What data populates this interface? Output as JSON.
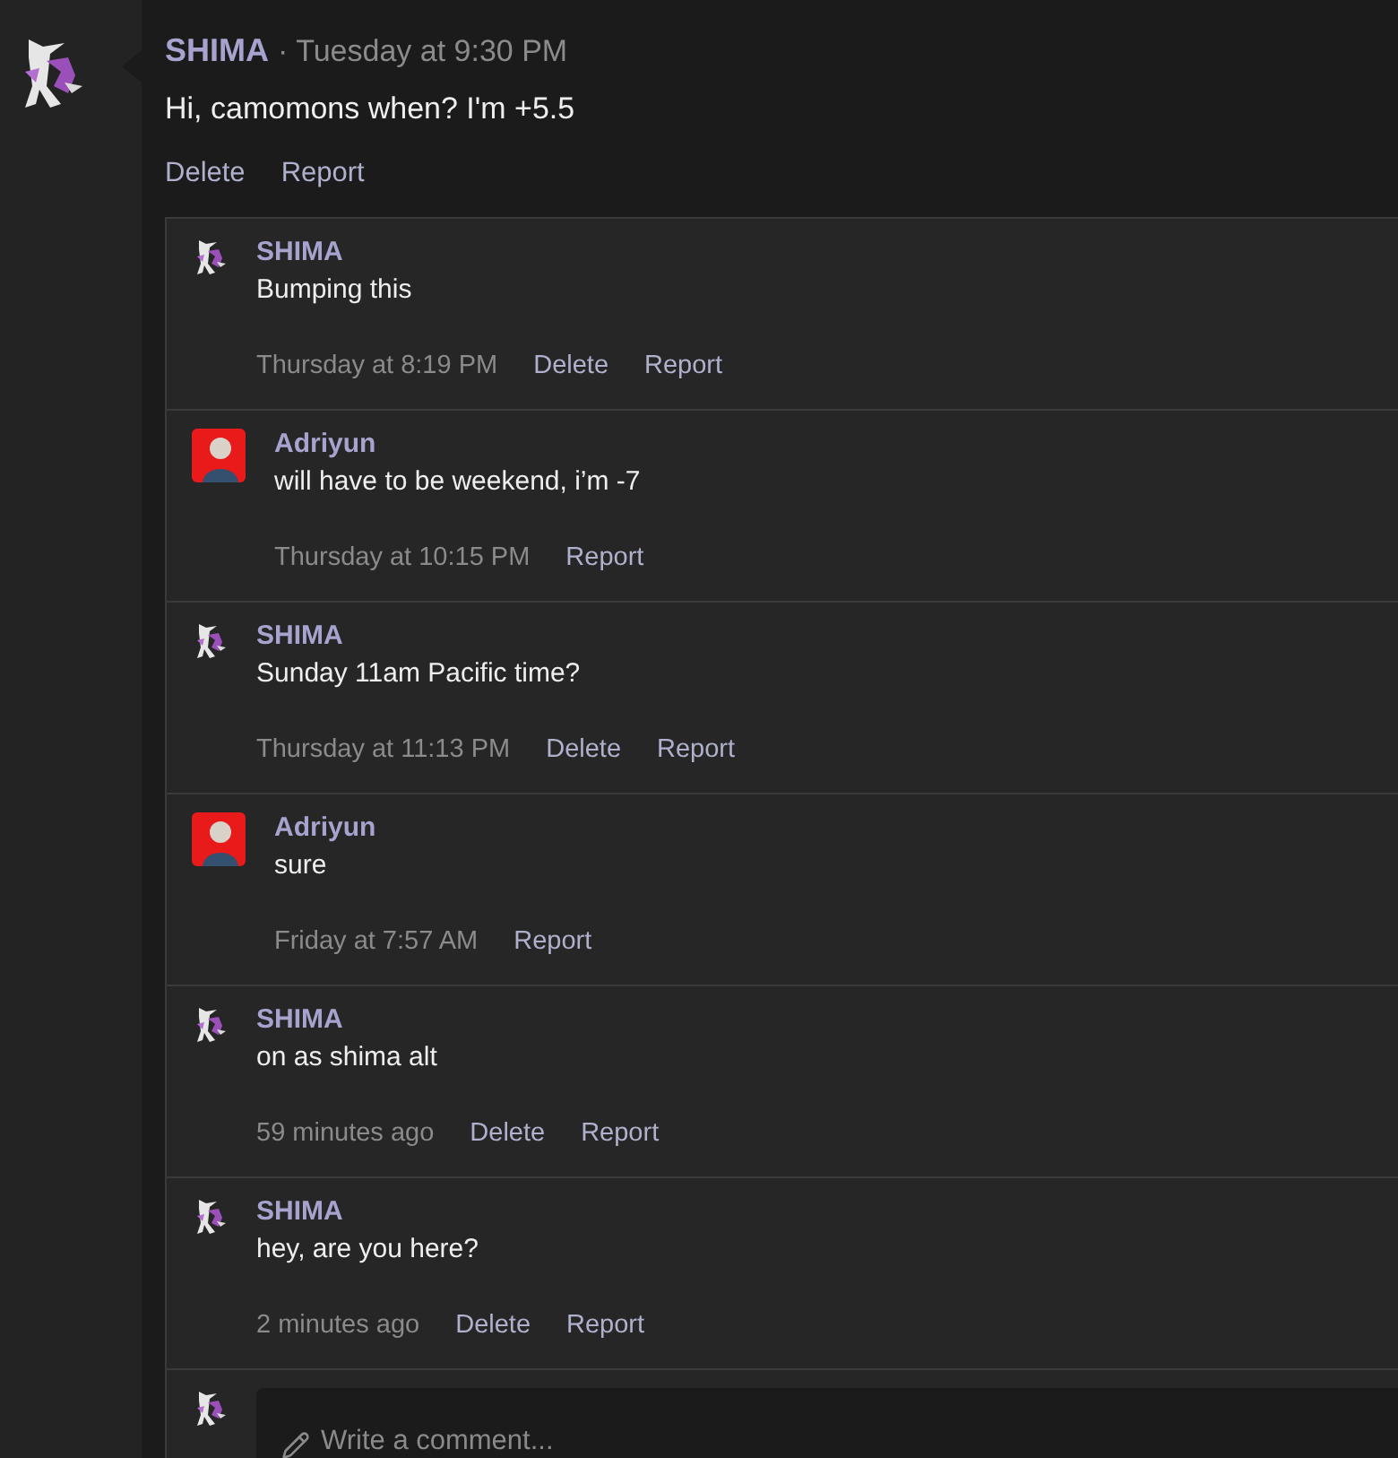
{
  "post": {
    "author": "SHIMA",
    "avatar": {
      "kind": "shima"
    },
    "time": "· Tuesday at 9:30 PM",
    "text": "Hi, camomons when? I'm +5.5",
    "actions": [
      "Delete",
      "Report"
    ]
  },
  "comments": [
    {
      "author": "SHIMA",
      "avatar": {
        "kind": "shima"
      },
      "text": "Bumping this",
      "time": "Thursday at 8:19 PM",
      "actions": [
        "Delete",
        "Report"
      ]
    },
    {
      "author": "Adriyun",
      "avatar": {
        "kind": "adriyun"
      },
      "text": "will have to be weekend, i’m -7",
      "time": "Thursday at 10:15 PM",
      "actions": [
        "Report"
      ]
    },
    {
      "author": "SHIMA",
      "avatar": {
        "kind": "shima"
      },
      "text": "Sunday 11am Pacific time?",
      "time": "Thursday at 11:13 PM",
      "actions": [
        "Delete",
        "Report"
      ]
    },
    {
      "author": "Adriyun",
      "avatar": {
        "kind": "adriyun"
      },
      "text": "sure",
      "time": "Friday at 7:57 AM",
      "actions": [
        "Report"
      ]
    },
    {
      "author": "SHIMA",
      "avatar": {
        "kind": "shima"
      },
      "text": "on as shima alt",
      "time": "59 minutes ago",
      "actions": [
        "Delete",
        "Report"
      ]
    },
    {
      "author": "SHIMA",
      "avatar": {
        "kind": "shima"
      },
      "text": "hey, are you here?",
      "time": "2 minutes ago",
      "actions": [
        "Delete",
        "Report"
      ]
    }
  ],
  "composer": {
    "avatar": {
      "kind": "shima"
    },
    "placeholder": "Write a comment..."
  }
}
